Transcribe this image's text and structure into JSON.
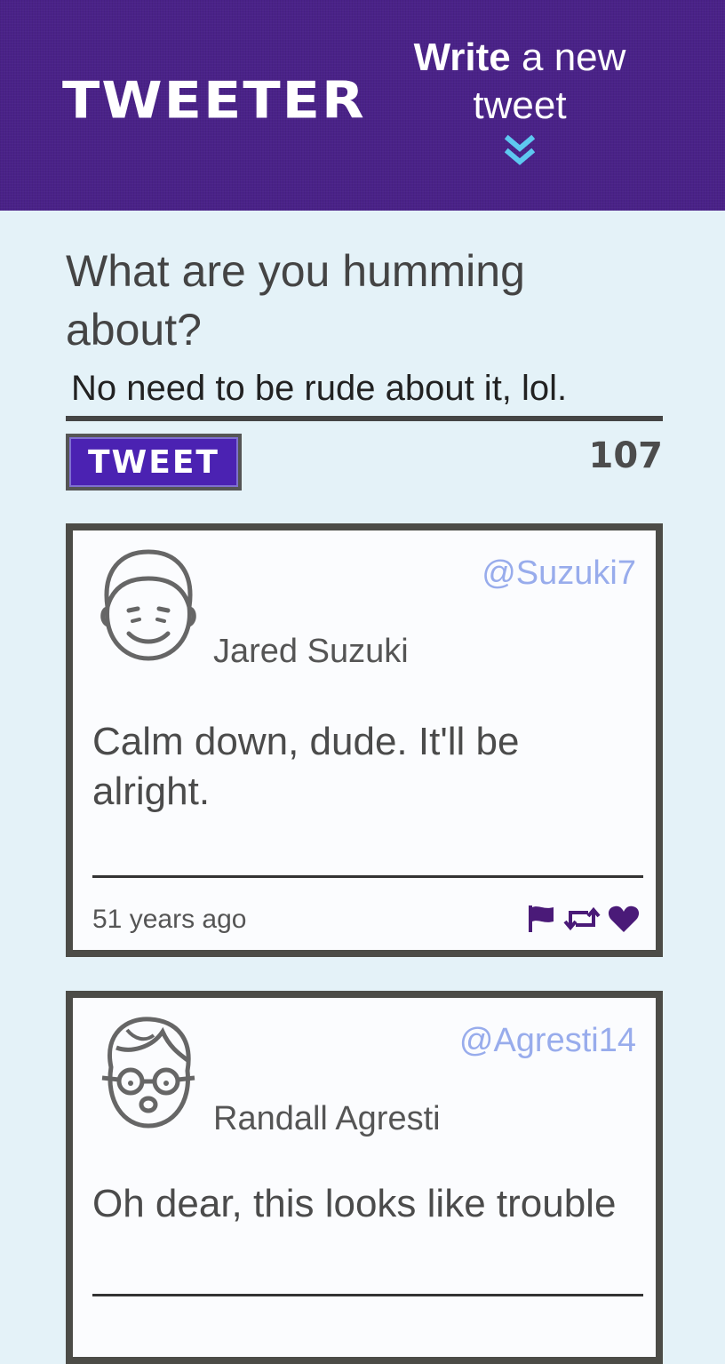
{
  "nav": {
    "brand": "TWEETER",
    "compose_strong": "Write",
    "compose_rest": " a new tweet"
  },
  "new_tweet": {
    "prompt": "What are you humming about?",
    "input_value": "No need to be rude about it, lol.",
    "button_label": "TWEET",
    "counter": "107"
  },
  "tweets": [
    {
      "name": "Jared Suzuki",
      "handle": "@Suzuki7",
      "text": "Calm down, dude. It'll be alright.",
      "time": "51 years ago",
      "avatar_icon": "smiling-face-avatar-icon"
    },
    {
      "name": "Randall Agresti",
      "handle": "@Agresti14",
      "text": "Oh dear, this looks like trouble",
      "avatar_icon": "glasses-face-avatar-icon"
    }
  ],
  "colors": {
    "nav_bg": "#4a2288",
    "page_bg": "#e4f2f8",
    "accent_purple": "#4b22b2",
    "handle_blue": "#98acec",
    "chevron_blue": "#5ec8f0",
    "icon_purple": "#4a1a78"
  },
  "icons": {
    "chevron": "double-chevron-down-icon",
    "flag": "flag-icon",
    "retweet": "retweet-icon",
    "like": "heart-icon"
  }
}
